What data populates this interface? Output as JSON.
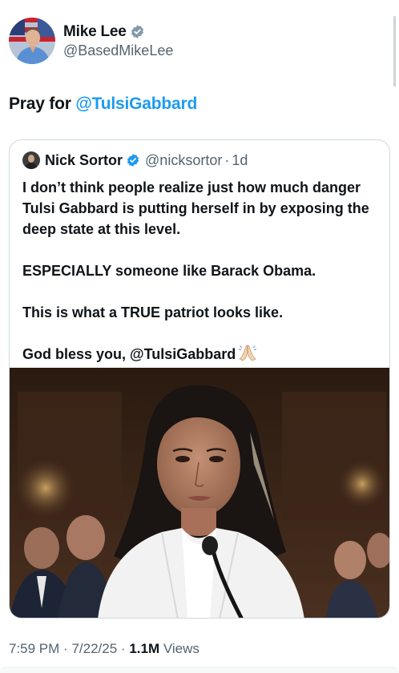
{
  "post": {
    "author": {
      "display_name": "Mike Lee",
      "handle": "@BasedMikeLee",
      "verified_icon": "verified-badge-icon",
      "avatar": "avatar"
    },
    "text_prefix": "Pray for",
    "text_mention": "@TulsiGabbard",
    "quote": {
      "author": {
        "display_name": "Nick Sortor",
        "handle": "@nicksortor",
        "separator": "·",
        "age": "1d"
      },
      "lines": [
        "I don’t think people realize just how much danger Tulsi Gabbard is putting herself in by exposing the deep state at this level.",
        "ESPECIALLY someone like Barack Obama.",
        "This is what a TRUE patriot looks like.",
        "God bless you, @TulsiGabbard"
      ],
      "emoji": "folded-hands-icon",
      "media": "photo"
    },
    "meta": {
      "time": "7:59 PM",
      "sep1": "·",
      "date": "7/22/25",
      "sep2": "·",
      "views_count": "1.1M",
      "views_label": "Views"
    },
    "colors": {
      "accent": "#1d9bf0",
      "text": "#0f1419",
      "secondary": "#536471",
      "border": "#cfd9de"
    }
  }
}
